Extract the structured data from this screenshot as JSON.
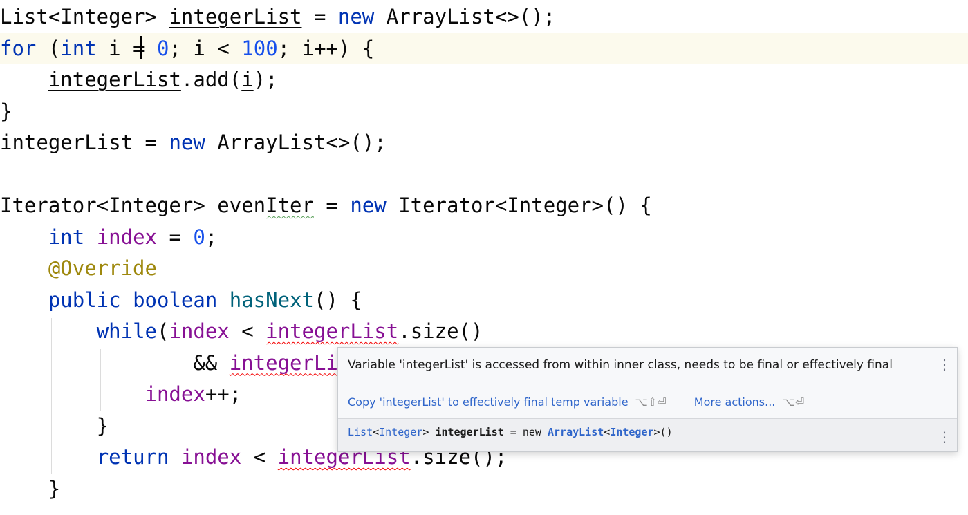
{
  "editor": {
    "lines": [
      [
        {
          "t": "List<Integer> "
        },
        {
          "t": "integerList",
          "c": "ul"
        },
        {
          "t": " = "
        },
        {
          "t": "new",
          "c": "kw"
        },
        {
          "t": " ArrayList<>();"
        }
      ],
      [
        {
          "t": "for",
          "c": "kw"
        },
        {
          "t": " ("
        },
        {
          "t": "int",
          "c": "kw"
        },
        {
          "t": " "
        },
        {
          "t": "i",
          "c": "ul"
        },
        {
          "t": " = "
        },
        {
          "t": "0",
          "c": "num"
        },
        {
          "t": "; "
        },
        {
          "t": "i",
          "c": "ul"
        },
        {
          "t": " < "
        },
        {
          "t": "100",
          "c": "num"
        },
        {
          "t": "; "
        },
        {
          "t": "i",
          "c": "ul"
        },
        {
          "t": "++) {"
        }
      ],
      [
        {
          "t": "    "
        },
        {
          "t": "integerList",
          "c": "ul"
        },
        {
          "t": ".add("
        },
        {
          "t": "i",
          "c": "ul"
        },
        {
          "t": ");"
        }
      ],
      [
        {
          "t": "}"
        }
      ],
      [
        {
          "t": "integerList",
          "c": "ul"
        },
        {
          "t": " = "
        },
        {
          "t": "new",
          "c": "kw"
        },
        {
          "t": " ArrayList<>();"
        }
      ],
      [],
      [
        {
          "t": "Iterator<Integer> even"
        },
        {
          "t": "Iter",
          "c": "weak"
        },
        {
          "t": " = "
        },
        {
          "t": "new",
          "c": "kw"
        },
        {
          "t": " Iterator<Integer>() {"
        }
      ],
      [
        {
          "t": "    "
        },
        {
          "t": "int",
          "c": "kw"
        },
        {
          "t": " "
        },
        {
          "t": "index",
          "c": "fld"
        },
        {
          "t": " = "
        },
        {
          "t": "0",
          "c": "num"
        },
        {
          "t": ";"
        }
      ],
      [
        {
          "t": "    "
        },
        {
          "t": "@Override",
          "c": "ann"
        }
      ],
      [
        {
          "t": "    "
        },
        {
          "t": "public",
          "c": "kw"
        },
        {
          "t": " "
        },
        {
          "t": "boolean",
          "c": "kw"
        },
        {
          "t": " "
        },
        {
          "t": "hasNext",
          "c": "fn"
        },
        {
          "t": "() {"
        }
      ],
      [
        {
          "t": "        "
        },
        {
          "t": "while",
          "c": "kw"
        },
        {
          "t": "("
        },
        {
          "t": "index",
          "c": "fld"
        },
        {
          "t": " < "
        },
        {
          "t": "integerList",
          "c": "err fld"
        },
        {
          "t": ".size()"
        }
      ],
      [
        {
          "t": "                && "
        },
        {
          "t": "integerList",
          "c": "err fld"
        }
      ],
      [
        {
          "t": "            "
        },
        {
          "t": "index",
          "c": "fld"
        },
        {
          "t": "++;"
        }
      ],
      [
        {
          "t": "        }"
        }
      ],
      [
        {
          "t": "        "
        },
        {
          "t": "return",
          "c": "kw"
        },
        {
          "t": " "
        },
        {
          "t": "index",
          "c": "fld"
        },
        {
          "t": " < "
        },
        {
          "t": "integerList",
          "c": "err fld"
        },
        {
          "t": ".size();"
        }
      ],
      [
        {
          "t": "    }"
        }
      ]
    ]
  },
  "popup": {
    "message": "Variable 'integerList' is accessed from within inner class, needs to be final or effectively final",
    "primary_action": "Copy 'integerList' to effectively final temp variable",
    "primary_shortcut": "⌥⇧⏎",
    "more_actions": "More actions...",
    "more_shortcut": "⌥⏎",
    "declaration": [
      {
        "t": "List",
        "c": "t"
      },
      {
        "t": "<"
      },
      {
        "t": "Integer",
        "c": "t"
      },
      {
        "t": "> "
      },
      {
        "t": "integerList",
        "c": "b"
      },
      {
        "t": " = new "
      },
      {
        "t": "ArrayList",
        "c": "tb"
      },
      {
        "t": "<"
      },
      {
        "t": "Integer",
        "c": "tb"
      },
      {
        "t": ">()"
      }
    ],
    "menu_icon": "vertical-ellipsis-icon"
  }
}
